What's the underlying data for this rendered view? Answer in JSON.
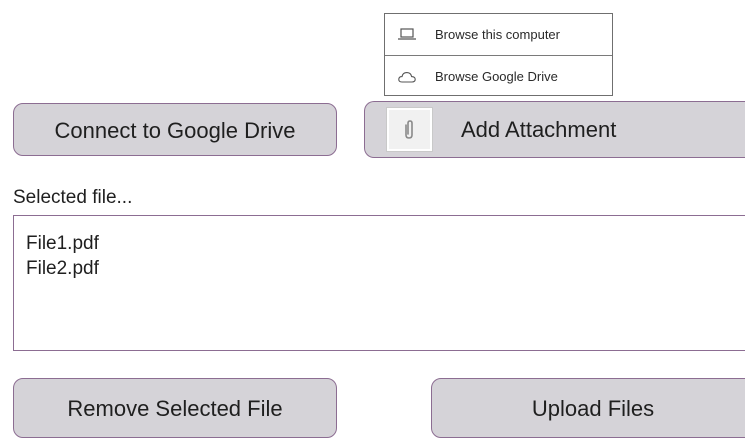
{
  "dropdown": {
    "items": [
      {
        "label": "Browse this computer",
        "icon": "laptop-icon"
      },
      {
        "label": "Browse Google Drive",
        "icon": "cloud-icon"
      }
    ]
  },
  "buttons": {
    "connect_drive": "Connect to Google Drive",
    "add_attachment": "Add Attachment",
    "add_attachment_icon": "paperclip-icon",
    "remove_selected": "Remove Selected File",
    "upload_files": "Upload Files"
  },
  "selected": {
    "label": "Selected file...",
    "files": [
      "File1.pdf",
      "File2.pdf"
    ]
  },
  "colors": {
    "button_fill": "#d5d3d8",
    "button_border": "#8c6d92",
    "list_border": "#8c6d92"
  }
}
